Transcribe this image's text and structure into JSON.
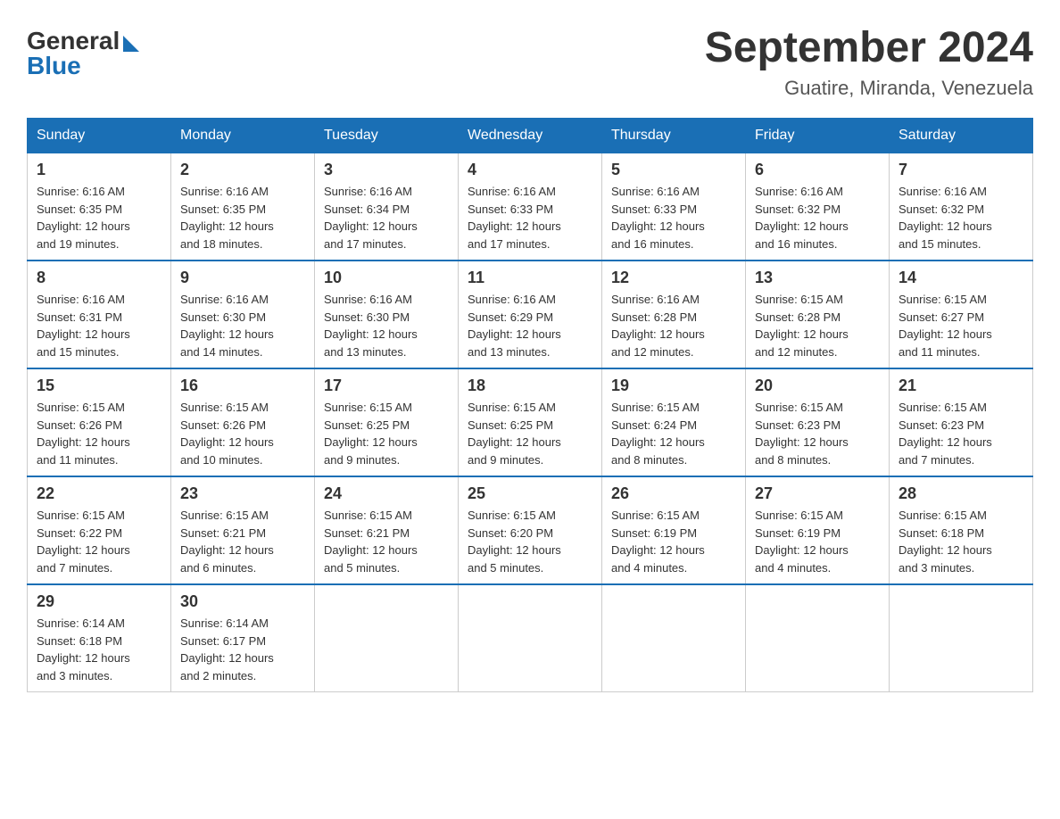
{
  "header": {
    "logo_general": "General",
    "logo_blue": "Blue",
    "month_title": "September 2024",
    "location": "Guatire, Miranda, Venezuela"
  },
  "weekdays": [
    "Sunday",
    "Monday",
    "Tuesday",
    "Wednesday",
    "Thursday",
    "Friday",
    "Saturday"
  ],
  "weeks": [
    [
      {
        "day": "1",
        "sunrise": "6:16 AM",
        "sunset": "6:35 PM",
        "daylight": "12 hours and 19 minutes."
      },
      {
        "day": "2",
        "sunrise": "6:16 AM",
        "sunset": "6:35 PM",
        "daylight": "12 hours and 18 minutes."
      },
      {
        "day": "3",
        "sunrise": "6:16 AM",
        "sunset": "6:34 PM",
        "daylight": "12 hours and 17 minutes."
      },
      {
        "day": "4",
        "sunrise": "6:16 AM",
        "sunset": "6:33 PM",
        "daylight": "12 hours and 17 minutes."
      },
      {
        "day": "5",
        "sunrise": "6:16 AM",
        "sunset": "6:33 PM",
        "daylight": "12 hours and 16 minutes."
      },
      {
        "day": "6",
        "sunrise": "6:16 AM",
        "sunset": "6:32 PM",
        "daylight": "12 hours and 16 minutes."
      },
      {
        "day": "7",
        "sunrise": "6:16 AM",
        "sunset": "6:32 PM",
        "daylight": "12 hours and 15 minutes."
      }
    ],
    [
      {
        "day": "8",
        "sunrise": "6:16 AM",
        "sunset": "6:31 PM",
        "daylight": "12 hours and 15 minutes."
      },
      {
        "day": "9",
        "sunrise": "6:16 AM",
        "sunset": "6:30 PM",
        "daylight": "12 hours and 14 minutes."
      },
      {
        "day": "10",
        "sunrise": "6:16 AM",
        "sunset": "6:30 PM",
        "daylight": "12 hours and 13 minutes."
      },
      {
        "day": "11",
        "sunrise": "6:16 AM",
        "sunset": "6:29 PM",
        "daylight": "12 hours and 13 minutes."
      },
      {
        "day": "12",
        "sunrise": "6:16 AM",
        "sunset": "6:28 PM",
        "daylight": "12 hours and 12 minutes."
      },
      {
        "day": "13",
        "sunrise": "6:15 AM",
        "sunset": "6:28 PM",
        "daylight": "12 hours and 12 minutes."
      },
      {
        "day": "14",
        "sunrise": "6:15 AM",
        "sunset": "6:27 PM",
        "daylight": "12 hours and 11 minutes."
      }
    ],
    [
      {
        "day": "15",
        "sunrise": "6:15 AM",
        "sunset": "6:26 PM",
        "daylight": "12 hours and 11 minutes."
      },
      {
        "day": "16",
        "sunrise": "6:15 AM",
        "sunset": "6:26 PM",
        "daylight": "12 hours and 10 minutes."
      },
      {
        "day": "17",
        "sunrise": "6:15 AM",
        "sunset": "6:25 PM",
        "daylight": "12 hours and 9 minutes."
      },
      {
        "day": "18",
        "sunrise": "6:15 AM",
        "sunset": "6:25 PM",
        "daylight": "12 hours and 9 minutes."
      },
      {
        "day": "19",
        "sunrise": "6:15 AM",
        "sunset": "6:24 PM",
        "daylight": "12 hours and 8 minutes."
      },
      {
        "day": "20",
        "sunrise": "6:15 AM",
        "sunset": "6:23 PM",
        "daylight": "12 hours and 8 minutes."
      },
      {
        "day": "21",
        "sunrise": "6:15 AM",
        "sunset": "6:23 PM",
        "daylight": "12 hours and 7 minutes."
      }
    ],
    [
      {
        "day": "22",
        "sunrise": "6:15 AM",
        "sunset": "6:22 PM",
        "daylight": "12 hours and 7 minutes."
      },
      {
        "day": "23",
        "sunrise": "6:15 AM",
        "sunset": "6:21 PM",
        "daylight": "12 hours and 6 minutes."
      },
      {
        "day": "24",
        "sunrise": "6:15 AM",
        "sunset": "6:21 PM",
        "daylight": "12 hours and 5 minutes."
      },
      {
        "day": "25",
        "sunrise": "6:15 AM",
        "sunset": "6:20 PM",
        "daylight": "12 hours and 5 minutes."
      },
      {
        "day": "26",
        "sunrise": "6:15 AM",
        "sunset": "6:19 PM",
        "daylight": "12 hours and 4 minutes."
      },
      {
        "day": "27",
        "sunrise": "6:15 AM",
        "sunset": "6:19 PM",
        "daylight": "12 hours and 4 minutes."
      },
      {
        "day": "28",
        "sunrise": "6:15 AM",
        "sunset": "6:18 PM",
        "daylight": "12 hours and 3 minutes."
      }
    ],
    [
      {
        "day": "29",
        "sunrise": "6:14 AM",
        "sunset": "6:18 PM",
        "daylight": "12 hours and 3 minutes."
      },
      {
        "day": "30",
        "sunrise": "6:14 AM",
        "sunset": "6:17 PM",
        "daylight": "12 hours and 2 minutes."
      },
      null,
      null,
      null,
      null,
      null
    ]
  ],
  "labels": {
    "sunrise": "Sunrise:",
    "sunset": "Sunset:",
    "daylight": "Daylight:"
  }
}
